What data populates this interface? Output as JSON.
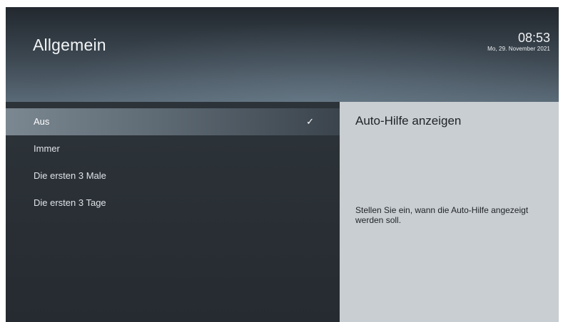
{
  "header": {
    "title": "Allgemein",
    "time": "08:53",
    "date": "Mo, 29. November 2021"
  },
  "menu": {
    "items": [
      {
        "label": "Aus",
        "selected": true
      },
      {
        "label": "Immer",
        "selected": false
      },
      {
        "label": "Die ersten 3 Male",
        "selected": false
      },
      {
        "label": "Die ersten 3 Tage",
        "selected": false
      }
    ],
    "check_glyph": "✓"
  },
  "info": {
    "title": "Auto-Hilfe anzeigen",
    "description": "Stellen Sie ein, wann die Auto-Hilfe angezeigt werden soll."
  },
  "colors": {
    "background_dark": "#2b3138",
    "selected_highlight": "#7b8791",
    "info_panel": "#c9ced2",
    "text_light": "#f2f4f6",
    "text_dark": "#1f2327"
  },
  "icons": {
    "selected_marker": "checkmark-icon"
  }
}
